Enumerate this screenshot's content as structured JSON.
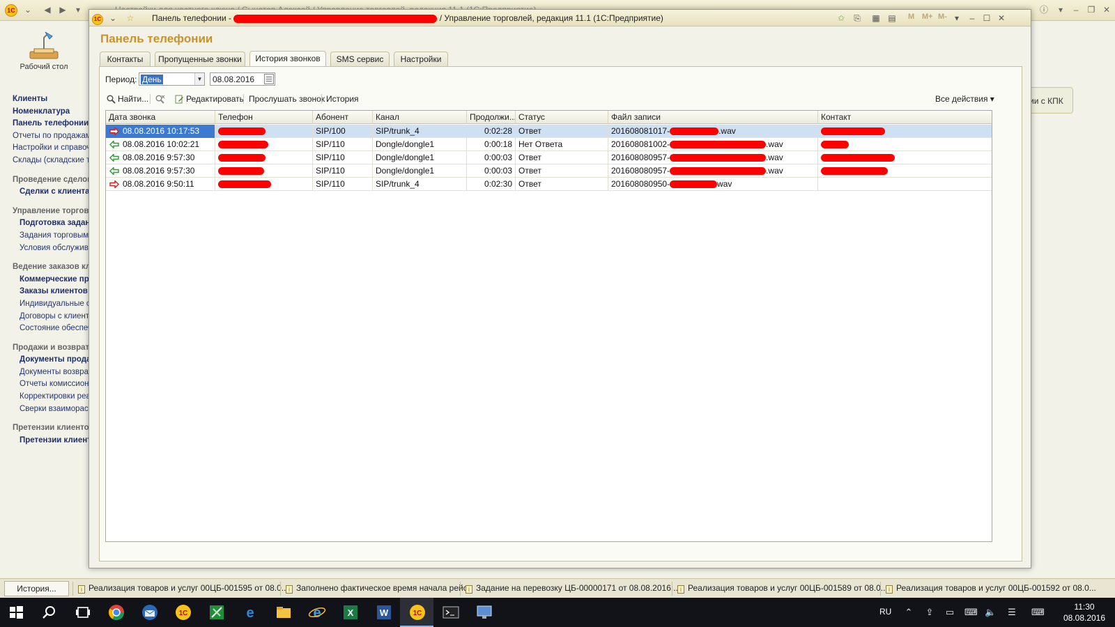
{
  "bg": {
    "title": "Настройки для частного ключа / Сычатов Алексей / Управление торговлей, редакция 11.1  (1С:Предприятие)",
    "desktop_label": "Рабочий стол",
    "desktop_extra": "М",
    "nav": [
      {
        "label": "Клиенты",
        "style": "bold"
      },
      {
        "label": "Номенклатура",
        "style": "bold"
      },
      {
        "label": "Панель телефонии",
        "style": "bold"
      },
      {
        "label": "Отчеты по продажам",
        "style": "plain"
      },
      {
        "label": "Настройки и справочники",
        "style": "plain"
      },
      {
        "label": "Склады (складские территории)",
        "style": "plain"
      },
      {
        "label": "Проведение сделок",
        "style": "section"
      },
      {
        "label": "Сделки с клиентами",
        "style": "bold-indent"
      },
      {
        "label": "Управление торговыми",
        "style": "section"
      },
      {
        "label": "Подготовка заданий",
        "style": "bold-indent"
      },
      {
        "label": "Задания торговым представителям",
        "style": "indent"
      },
      {
        "label": "Условия обслуживания",
        "style": "indent"
      },
      {
        "label": "Ведение заказов клиентов",
        "style": "section"
      },
      {
        "label": "Коммерческие предложения",
        "style": "bold-indent"
      },
      {
        "label": "Заказы клиентов",
        "style": "bold-indent"
      },
      {
        "label": "Индивидуальные соглашения",
        "style": "indent"
      },
      {
        "label": "Договоры с клиентами",
        "style": "indent"
      },
      {
        "label": "Состояние обеспечения",
        "style": "indent"
      },
      {
        "label": "Продажи и возвраты",
        "style": "section"
      },
      {
        "label": "Документы продажи",
        "style": "bold-indent"
      },
      {
        "label": "Документы возврата",
        "style": "indent"
      },
      {
        "label": "Отчеты комиссионеров",
        "style": "indent"
      },
      {
        "label": "Корректировки реализаций",
        "style": "indent"
      },
      {
        "label": "Сверки взаиморасчетов",
        "style": "indent"
      },
      {
        "label": "Претензии клиентов",
        "style": "section"
      },
      {
        "label": "Претензии клиентов",
        "style": "bold-indent"
      }
    ],
    "kpk_button": "ии с КПК",
    "history_button": "История...",
    "status_items": [
      "Реализация товаров и услуг 00ЦБ-001595 от 08.0...",
      "Заполнено фактическое время начала рейса",
      "Задание на перевозку ЦБ-00000171 от 08.08.2016...",
      "Реализация товаров и услуг 00ЦБ-001589 от 08.0...",
      "Реализация товаров и услуг 00ЦБ-001592 от 08.0..."
    ]
  },
  "window": {
    "title_prefix": "Панель телефонии -",
    "title_suffix": "/ Управление торговлей, редакция 11.1  (1С:Предприятие)",
    "m_buttons": [
      "M",
      "M+",
      "M-"
    ],
    "header": "Панель телефонии"
  },
  "tabs": [
    {
      "label": "Контакты",
      "active": false
    },
    {
      "label": "Пропущенные звонки",
      "active": false
    },
    {
      "label": "История звонков",
      "active": true
    },
    {
      "label": "SMS сервис",
      "active": false
    },
    {
      "label": "Настройки",
      "active": false
    }
  ],
  "period": {
    "label": "Период:",
    "value": "День",
    "date": "08.08.2016"
  },
  "toolbar": {
    "find": "Найти...",
    "edit": "Редактировать",
    "listen": "Прослушать звонок",
    "history": "История",
    "all_actions": "Все действия ▾"
  },
  "table": {
    "columns": [
      "Дата звонка",
      "Телефон",
      "Абонент",
      "Канал",
      "Продолжи...",
      "Статус",
      "Файл записи",
      "Контакт"
    ],
    "rows": [
      {
        "direction": "outgoing",
        "date": "08.08.2016 10:17:53",
        "subscriber": "SIP/100",
        "channel": "SIP/trunk_4",
        "duration": "0:02:28",
        "status": "Ответ",
        "file_prefix": "201608081017-",
        "file_suffix": ".wav",
        "selected": true
      },
      {
        "direction": "incoming",
        "date": "08.08.2016 10:02:21",
        "subscriber": "SIP/110",
        "channel": "Dongle/dongle1",
        "duration": "0:00:18",
        "status": "Нет Ответа",
        "file_prefix": "201608081002-",
        "file_suffix": ".wav",
        "selected": false
      },
      {
        "direction": "incoming",
        "date": "08.08.2016 9:57:30",
        "subscriber": "SIP/110",
        "channel": "Dongle/dongle1",
        "duration": "0:00:03",
        "status": "Ответ",
        "file_prefix": "201608080957-",
        "file_suffix": ".wav",
        "selected": false
      },
      {
        "direction": "incoming",
        "date": "08.08.2016 9:57:30",
        "subscriber": "SIP/110",
        "channel": "Dongle/dongle1",
        "duration": "0:00:03",
        "status": "Ответ",
        "file_prefix": "201608080957-",
        "file_suffix": ".wav",
        "selected": false
      },
      {
        "direction": "outgoing",
        "date": "08.08.2016 9:50:11",
        "subscriber": "SIP/110",
        "channel": "SIP/trunk_4",
        "duration": "0:02:30",
        "status": "Ответ",
        "file_prefix": "201608080950-",
        "file_suffix": "wav",
        "selected": false
      }
    ]
  },
  "taskbar": {
    "lang": "RU",
    "time": "11:30",
    "date": "08.08.2016"
  },
  "colors": {
    "accent_header": "#c8932c",
    "selection": "#3c7ad2",
    "redaction": "#ff0000",
    "outgoing_arrow": "#d21f1f",
    "incoming_arrow": "#2e9b2e"
  }
}
